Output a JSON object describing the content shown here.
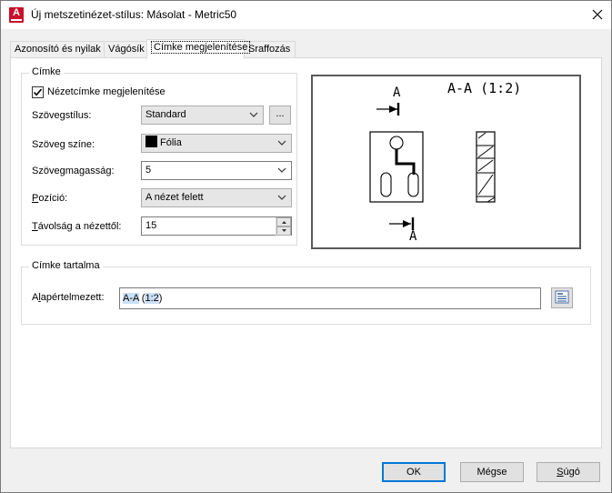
{
  "window": {
    "title": "Új metszetinézet-stílus: Másolat - Metric50",
    "app_icon_letter": "A",
    "close_glyph": "✕"
  },
  "tabs": [
    {
      "label": "Azonosító és nyilak"
    },
    {
      "label": "Vágósík"
    },
    {
      "label": "Címke megjelenítése"
    },
    {
      "label": "Sraffozás"
    }
  ],
  "label_group": {
    "legend": "Címke",
    "show_label_checkbox": {
      "label": "Nézetcímke megjelenítése",
      "checked": true
    },
    "text_style": {
      "label": "Szövegstílus:",
      "value": "Standard",
      "browse_label": "..."
    },
    "text_color": {
      "label": "Szöveg színe:",
      "value": "Fólia",
      "swatch_color": "#000000"
    },
    "text_height": {
      "label": "Szövegmagasság:",
      "value": "5"
    },
    "position": {
      "label": "Pozíció:",
      "value": "A nézet felett"
    },
    "distance": {
      "label": "Távolság a nézettől:",
      "value": "15"
    }
  },
  "preview": {
    "top_letter": "A",
    "label_text": "A-A (1:2)",
    "bottom_letter": "A"
  },
  "content_group": {
    "legend": "Címke tartalma",
    "default_label": "Alapértelmezett:",
    "default_value_parts": [
      "A-A",
      " (",
      "1:2",
      ")"
    ]
  },
  "buttons": {
    "ok": "OK",
    "cancel": "Mégse",
    "help": "Súgó"
  }
}
